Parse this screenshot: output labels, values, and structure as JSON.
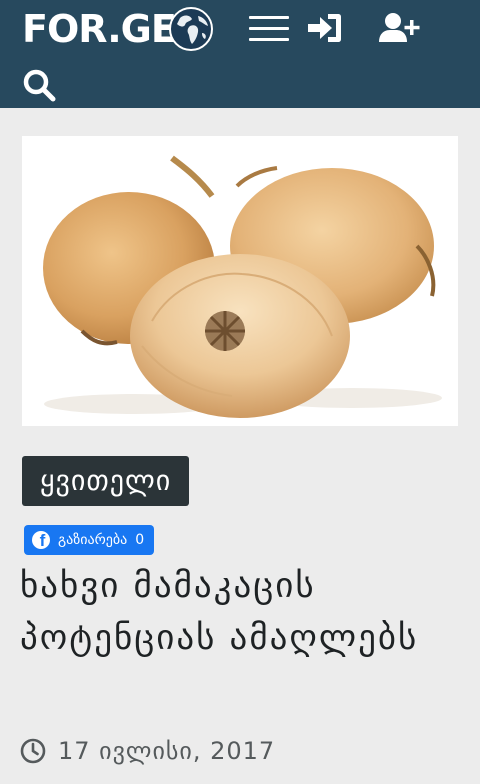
{
  "header": {
    "logo_text": "FOR.GE",
    "icons": [
      "globe-icon",
      "menu-icon",
      "sign-in-icon",
      "add-user-icon",
      "search-icon"
    ],
    "background_color": "#27495e"
  },
  "article": {
    "hero_image": "onions",
    "category": "ყვითელი",
    "share": {
      "label": "გაზიარება",
      "count": "0",
      "color": "#1877f2"
    },
    "title": "ხახვი მამაკაცის პოტენციას ამაღლებს",
    "date": "17 ივლისი, 2017"
  }
}
